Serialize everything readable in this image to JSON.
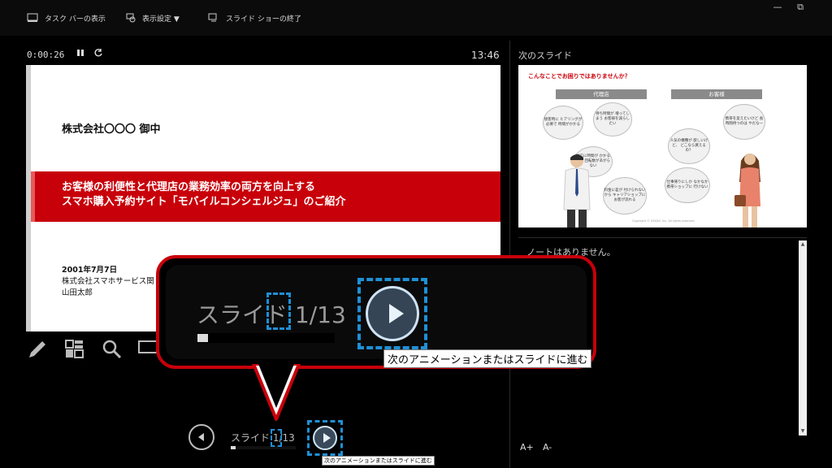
{
  "toolbar": {
    "taskbar_label": "タスク バーの表示",
    "display_settings_label": "表示設定 ▼",
    "end_show_label": "スライド ショーの終了"
  },
  "window": {
    "minimize": "—",
    "restore": "⧉"
  },
  "presenter": {
    "elapsed_time": "0:00:26",
    "clock": "13:46"
  },
  "current_slide": {
    "client": "株式会社〇〇〇 御中",
    "title_line1": "お客様の利便性と代理店の業務効率の両方を向上する",
    "title_line2": "スマホ購入予約サイト「モバイルコンシェルジュ」のご紹介",
    "date": "2001年7月7日",
    "company": "株式会社スマホサービス関",
    "person": "山田太郎"
  },
  "next_slide": {
    "label": "次のスライド",
    "title": "こんなことでお困りではありませんか？",
    "agency_header": "代理店",
    "customer_header": "お客様",
    "bubbles": {
      "b1": "接客時に ヒアリングが必要で 時間がかかる",
      "b2": "待ち時間が 増ってしまう お客様を減らしたい",
      "b3": "対応に時間が かかるので 回転数があがらない",
      "b4": "料金に差が 付けられないから キャリアショップに お客が流れる",
      "b5": "携帯を変えたいけど 長時間待つのは やだなー",
      "b6": "人気の機種が 欲しいけど、 どこなら買えるの？",
      "b7": "仕事帰りにしか なかなか携帯ショップに 行けない"
    },
    "footer": "Copyright © XXXXX, Inc. All rights reserved."
  },
  "notes": {
    "text": "ノートはありません。",
    "font_increase": "A+",
    "font_decrease": "A-"
  },
  "navigation": {
    "slide_counter": "スライド 1/13",
    "current": 1,
    "total": 13,
    "progress": 0.077,
    "next_tooltip": "次のアニメーションまたはスライドに進む"
  },
  "callout": {
    "slide_counter": "スライド 1/13",
    "tooltip": "次のアニメーションまたはスライドに進む"
  },
  "colors": {
    "accent_red": "#c8000a",
    "highlight_blue": "#1e90d6"
  }
}
